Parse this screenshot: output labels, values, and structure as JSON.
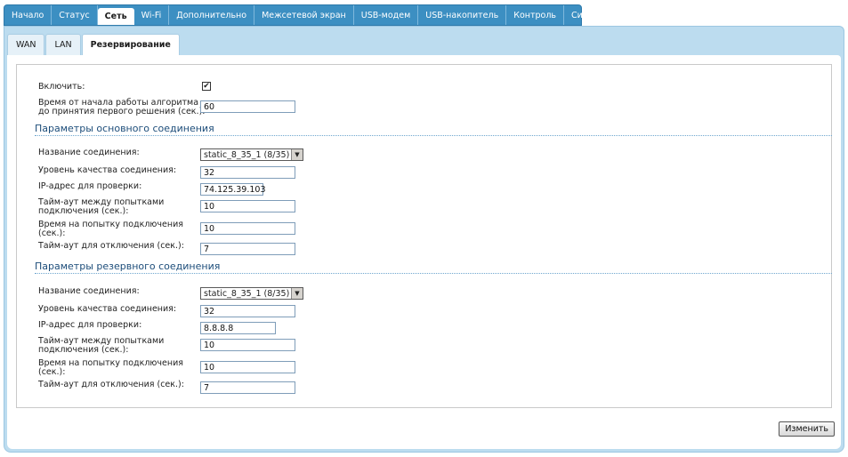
{
  "top_tabs": [
    {
      "label": "Начало"
    },
    {
      "label": "Статус"
    },
    {
      "label": "Сеть"
    },
    {
      "label": "Wi-Fi"
    },
    {
      "label": "Дополнительно"
    },
    {
      "label": "Межсетевой экран"
    },
    {
      "label": "USB-модем"
    },
    {
      "label": "USB-накопитель"
    },
    {
      "label": "Контроль"
    },
    {
      "label": "Система"
    }
  ],
  "active_top_tab": "Сеть",
  "sub_tabs": [
    {
      "label": "WAN"
    },
    {
      "label": "LAN"
    },
    {
      "label": "Резервирование"
    }
  ],
  "active_sub_tab": "Резервирование",
  "general": {
    "enable_label": "Включить:",
    "enable_checked": "☑",
    "time_label_1": "Время от начала работы алгоритма",
    "time_label_2": "до принятия первого решения (сек.):",
    "time_value": "60"
  },
  "primary": {
    "title": "Параметры основного соединения",
    "conn_name_label": "Название соединения:",
    "conn_name_value": "static_8_35_1 (8/35)",
    "quality_label": "Уровень качества соединения:",
    "quality_value": "32",
    "ip_label": "IP-адрес для проверки:",
    "ip_value": "74.125.39.103",
    "retry_timeout_label_1": "Тайм-аут между попытками",
    "retry_timeout_label_2": "подключения (сек.):",
    "retry_timeout_value": "10",
    "attempt_time_label_1": "Время на попытку подключения",
    "attempt_time_label_2": "(сек.):",
    "attempt_time_value": "10",
    "disconnect_label": "Тайм-аут для отключения (сек.):",
    "disconnect_value": "7"
  },
  "backup": {
    "title": "Параметры резервного соединения",
    "conn_name_label": "Название соединения:",
    "conn_name_value": "static_8_35_1 (8/35)",
    "quality_label": "Уровень качества соединения:",
    "quality_value": "32",
    "ip_label": "IP-адрес для проверки:",
    "ip_value": "8.8.8.8",
    "retry_timeout_label_1": "Тайм-аут между попытками",
    "retry_timeout_label_2": "подключения (сек.):",
    "retry_timeout_value": "10",
    "attempt_time_label_1": "Время на попытку подключения",
    "attempt_time_label_2": "(сек.):",
    "attempt_time_value": "10",
    "disconnect_label": "Тайм-аут для отключения (сек.):",
    "disconnect_value": "7"
  },
  "apply_label": "Изменить"
}
